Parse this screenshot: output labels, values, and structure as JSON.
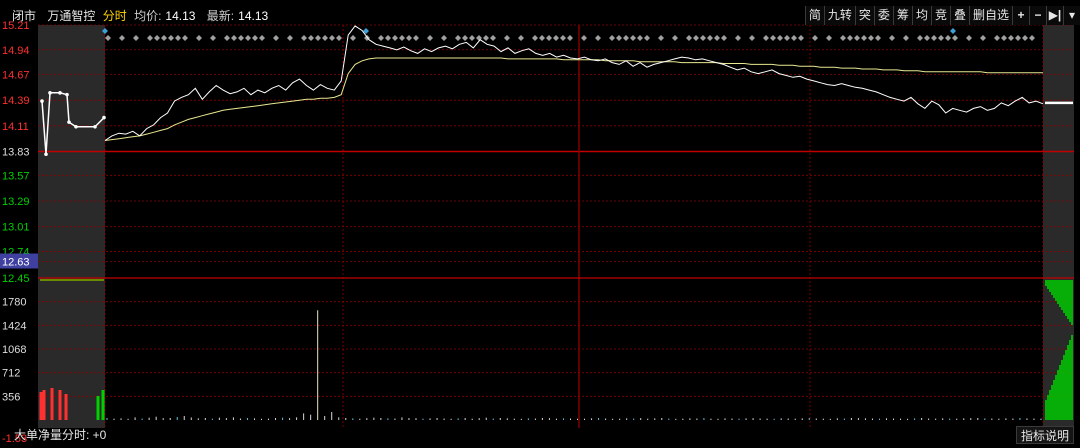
{
  "header": {
    "status": "闭市",
    "stock_name": "万通智控",
    "mode": "分时",
    "avg_label": "均价:",
    "avg_value": "14.13",
    "latest_label": "最新:",
    "latest_value": "14.13"
  },
  "toolbar": {
    "items": [
      "简",
      "九转",
      "突",
      "委",
      "筹",
      "均",
      "竞",
      "叠",
      "删自选",
      "+",
      "−",
      "▶|",
      "▾"
    ]
  },
  "price_axis": {
    "labels": [
      "15.21",
      "14.94",
      "14.67",
      "14.39",
      "14.11",
      "13.83",
      "13.57",
      "13.29",
      "13.01",
      "12.74",
      "12.63",
      "12.45"
    ],
    "prev_close": "13.83",
    "highlight": "12.63"
  },
  "volume_axis": {
    "labels": [
      "1780",
      "1424",
      "1068",
      "712",
      "356",
      "-1.53"
    ]
  },
  "footer": {
    "indicator": "大单净量分时: +0",
    "help_label": "指标说明"
  },
  "colors": {
    "up": "#ff3030",
    "down": "#00d000",
    "price_line": "#ffffff",
    "avg_line": "#e8e890",
    "grid": "#8b0000",
    "marker_gray": "#a0a0a0",
    "marker_blue": "#3da0d8"
  },
  "chart_data": {
    "type": "line",
    "title": "",
    "ylim": [
      12.45,
      15.21
    ],
    "series": [
      {
        "values": [
          13.95,
          14.0,
          14.03,
          14.02,
          14.05,
          14.0,
          14.08,
          14.12,
          14.2,
          14.25,
          14.38,
          14.42,
          14.45,
          14.52,
          14.4,
          14.48,
          14.55,
          14.5,
          14.46,
          14.48,
          14.52,
          14.45,
          14.5,
          14.47,
          14.52,
          14.55,
          14.5,
          14.58,
          14.62,
          14.55,
          14.5,
          14.56,
          14.52,
          14.5,
          14.6,
          15.1,
          15.2,
          15.15,
          15.05,
          15.0,
          14.98,
          14.96,
          14.94,
          14.97,
          14.93,
          14.9,
          14.95,
          14.92,
          14.96,
          14.98,
          14.95,
          15.0,
          15.02,
          14.96,
          15.05,
          15.0,
          14.98,
          14.92,
          14.96,
          14.9,
          14.93,
          14.95,
          14.9,
          14.88,
          14.9,
          14.86,
          14.88,
          14.85,
          14.84,
          14.86,
          14.83,
          14.82,
          14.84,
          14.8,
          14.78,
          14.82,
          14.76,
          14.8,
          14.75,
          14.78,
          14.8,
          14.82,
          14.84,
          14.86,
          14.85,
          14.83,
          14.84,
          14.82,
          14.8,
          14.78,
          14.75,
          14.72,
          14.74,
          14.7,
          14.68,
          14.7,
          14.72,
          14.68,
          14.66,
          14.64,
          14.65,
          14.62,
          14.6,
          14.58,
          14.56,
          14.55,
          14.57,
          14.55,
          14.53,
          14.52,
          14.5,
          14.48,
          14.45,
          14.42,
          14.4,
          14.38,
          14.42,
          14.35,
          14.3,
          14.38,
          14.34,
          14.25,
          14.3,
          14.28,
          14.26,
          14.3,
          14.32,
          14.28,
          14.3,
          14.36,
          14.33,
          14.38,
          14.42,
          14.36,
          14.38,
          14.35
        ]
      },
      {
        "values": [
          13.95,
          13.96,
          13.97,
          13.98,
          13.99,
          14.0,
          14.02,
          14.04,
          14.06,
          14.08,
          14.12,
          14.15,
          14.18,
          14.2,
          14.22,
          14.24,
          14.26,
          14.28,
          14.29,
          14.3,
          14.31,
          14.32,
          14.33,
          14.34,
          14.35,
          14.36,
          14.37,
          14.38,
          14.39,
          14.4,
          14.4,
          14.41,
          14.41,
          14.42,
          14.45,
          14.68,
          14.78,
          14.82,
          14.84,
          14.85,
          14.85,
          14.85,
          14.85,
          14.85,
          14.85,
          14.85,
          14.85,
          14.85,
          14.85,
          14.85,
          14.85,
          14.85,
          14.85,
          14.85,
          14.85,
          14.85,
          14.85,
          14.85,
          14.84,
          14.84,
          14.84,
          14.84,
          14.84,
          14.84,
          14.84,
          14.84,
          14.83,
          14.83,
          14.83,
          14.83,
          14.83,
          14.83,
          14.82,
          14.82,
          14.82,
          14.82,
          14.82,
          14.81,
          14.81,
          14.81,
          14.81,
          14.81,
          14.81,
          14.8,
          14.8,
          14.8,
          14.8,
          14.8,
          14.8,
          14.79,
          14.79,
          14.79,
          14.79,
          14.78,
          14.78,
          14.78,
          14.78,
          14.77,
          14.77,
          14.77,
          14.76,
          14.76,
          14.76,
          14.75,
          14.75,
          14.75,
          14.74,
          14.74,
          14.74,
          14.73,
          14.73,
          14.73,
          14.72,
          14.72,
          14.72,
          14.71,
          14.71,
          14.71,
          14.7,
          14.7,
          14.7,
          14.7,
          14.7,
          14.7,
          14.7,
          14.7,
          14.7,
          14.69,
          14.69,
          14.69,
          14.69,
          14.69,
          14.69,
          14.69,
          14.69,
          14.69
        ]
      }
    ],
    "volume_bars": [
      30,
      20,
      25,
      18,
      40,
      22,
      35,
      50,
      28,
      30,
      45,
      60,
      38,
      25,
      30,
      20,
      35,
      28,
      40,
      22,
      30,
      25,
      18,
      20,
      30,
      35,
      28,
      40,
      100,
      80,
      1650,
      60,
      120,
      40,
      30,
      25,
      20,
      28,
      35,
      30,
      25,
      22,
      40,
      30,
      28,
      20,
      25,
      30,
      22,
      18,
      25,
      30,
      20,
      28,
      35,
      22,
      30,
      25,
      20,
      18,
      25,
      22,
      30,
      28,
      20,
      25,
      22,
      18,
      20,
      25,
      30,
      22,
      18,
      20,
      25,
      22,
      28,
      20,
      25,
      30,
      22,
      18,
      20,
      25,
      22,
      30,
      20,
      18,
      25,
      22,
      20,
      25,
      28,
      22,
      20,
      18,
      25,
      22,
      20,
      25,
      30,
      22,
      20,
      18,
      25,
      22,
      30,
      28,
      25,
      22,
      20,
      25,
      22,
      20,
      18,
      25,
      30,
      22,
      20,
      25,
      22,
      20,
      25,
      28,
      30,
      25,
      22,
      20,
      25,
      22,
      30,
      25,
      22,
      20
    ]
  }
}
